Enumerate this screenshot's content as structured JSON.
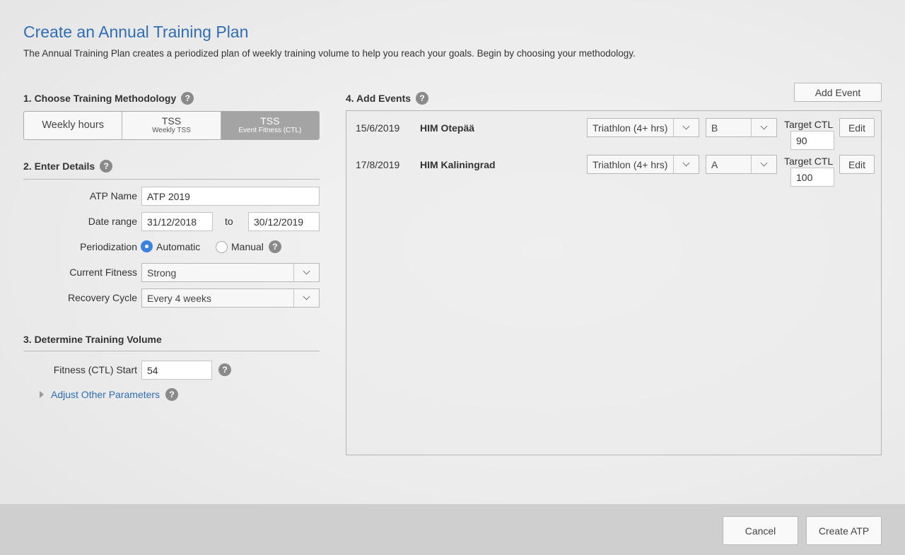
{
  "page": {
    "title": "Create an Annual Training Plan",
    "subtitle": "The Annual Training Plan creates a periodized plan of weekly training volume to help you reach your goals. Begin by choosing your methodology."
  },
  "sections": {
    "methodology": "1. Choose Training Methodology",
    "details": "2. Enter Details",
    "volume": "3. Determine Training Volume",
    "events": "4. Add Events"
  },
  "help_glyph": "?",
  "methodology": {
    "options": [
      {
        "main": "Weekly hours",
        "sub": ""
      },
      {
        "main": "TSS",
        "sub": "Weekly TSS"
      },
      {
        "main": "TSS",
        "sub": "Event Fitness (CTL)"
      }
    ],
    "selected": "Event Fitness (CTL)"
  },
  "details": {
    "atp_name_label": "ATP Name",
    "atp_name_value": "ATP 2019",
    "date_range_label": "Date range",
    "date_from": "31/12/2018",
    "date_to_label": "to",
    "date_to": "30/12/2019",
    "periodization_label": "Periodization",
    "periodization_automatic": "Automatic",
    "periodization_manual": "Manual",
    "periodization_selected": "Automatic",
    "current_fitness_label": "Current Fitness",
    "current_fitness_value": "Strong",
    "recovery_cycle_label": "Recovery Cycle",
    "recovery_cycle_value": "Every 4 weeks"
  },
  "volume": {
    "ctl_start_label": "Fitness (CTL) Start",
    "ctl_start_value": "54",
    "adjust_link": "Adjust Other Parameters"
  },
  "events": {
    "add_button": "Add Event",
    "target_ctl_label": "Target CTL",
    "edit_label": "Edit",
    "rows": [
      {
        "date": "15/6/2019",
        "name": "HIM Otepää",
        "type": "Triathlon (4+ hrs)",
        "priority": "B",
        "target_ctl": "90"
      },
      {
        "date": "17/8/2019",
        "name": "HIM Kaliningrad",
        "type": "Triathlon (4+ hrs)",
        "priority": "A",
        "target_ctl": "100"
      }
    ]
  },
  "footer": {
    "cancel": "Cancel",
    "create": "Create ATP"
  },
  "colors": {
    "accent": "#2f6db5",
    "radio_selected": "#3b82e0",
    "segment_active": "#a4a4a4"
  }
}
